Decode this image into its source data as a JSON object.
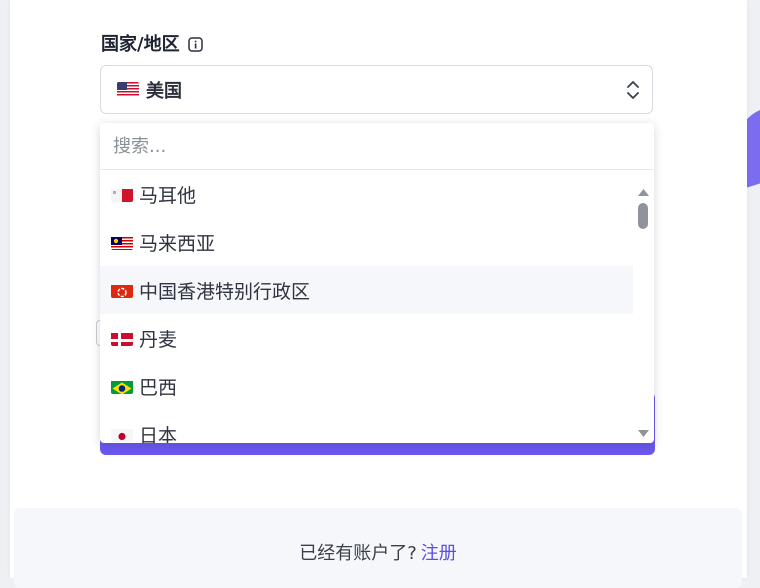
{
  "country_field": {
    "label": "国家/地区",
    "selected_value": "美国",
    "selected_flag": "us-flag"
  },
  "dropdown": {
    "search_placeholder": "搜索...",
    "items": [
      {
        "label": "马耳他",
        "flag": "mt-flag"
      },
      {
        "label": "马来西亚",
        "flag": "my-flag"
      },
      {
        "label": "中国香港特别行政区",
        "flag": "hk-flag",
        "hovered": true
      },
      {
        "label": "丹麦",
        "flag": "dk-flag"
      },
      {
        "label": "巴西",
        "flag": "br-flag"
      },
      {
        "label": "日本",
        "flag": "jp-flag"
      }
    ]
  },
  "footer": {
    "prompt": "已经有账户了?",
    "link": "注册"
  },
  "colors": {
    "accent": "#6a58ef",
    "link": "#5b4de6",
    "hover_row": "#f5f7fa"
  }
}
